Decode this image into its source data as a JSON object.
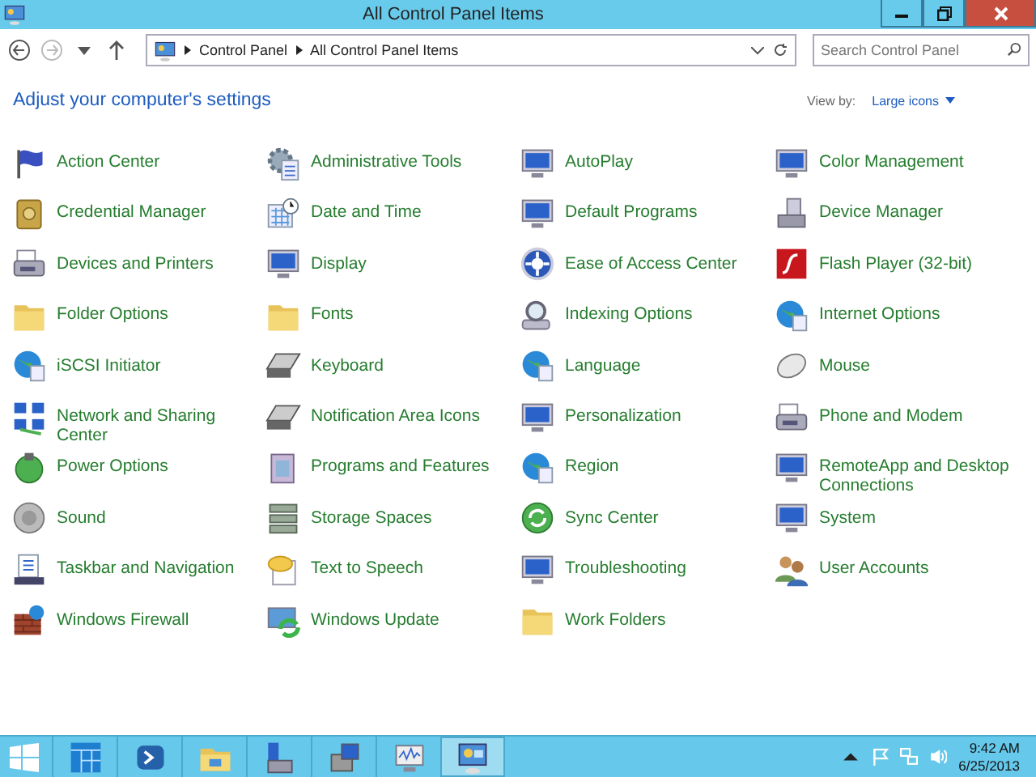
{
  "window": {
    "title": "All Control Panel Items"
  },
  "navigation": [
    {
      "kind": "back",
      "disabled": false
    },
    {
      "kind": "forward",
      "disabled": true
    },
    {
      "kind": "recent",
      "disabled": false
    },
    {
      "kind": "up",
      "disabled": false
    }
  ],
  "address_bar": {
    "path": [
      "Control Panel",
      "All Control Panel Items"
    ]
  },
  "search": {
    "placeholder": "Search Control Panel"
  },
  "heading": "Adjust your computer's settings",
  "view_by": {
    "label": "View by:",
    "value": "Large icons"
  },
  "items": [
    {
      "label": "Action Center"
    },
    {
      "label": "Administrative Tools"
    },
    {
      "label": "AutoPlay"
    },
    {
      "label": "Color Management"
    },
    {
      "label": "Credential Manager"
    },
    {
      "label": "Date and Time"
    },
    {
      "label": "Default Programs"
    },
    {
      "label": "Device Manager"
    },
    {
      "label": "Devices and Printers"
    },
    {
      "label": "Display"
    },
    {
      "label": "Ease of Access Center"
    },
    {
      "label": "Flash Player (32-bit)"
    },
    {
      "label": "Folder Options"
    },
    {
      "label": "Fonts"
    },
    {
      "label": "Indexing Options"
    },
    {
      "label": "Internet Options"
    },
    {
      "label": "iSCSI Initiator"
    },
    {
      "label": "Keyboard"
    },
    {
      "label": "Language"
    },
    {
      "label": "Mouse"
    },
    {
      "label": "Network and Sharing Center"
    },
    {
      "label": "Notification Area Icons"
    },
    {
      "label": "Personalization"
    },
    {
      "label": "Phone and Modem"
    },
    {
      "label": "Power Options"
    },
    {
      "label": "Programs and Features"
    },
    {
      "label": "Region"
    },
    {
      "label": "RemoteApp and Desktop Connections"
    },
    {
      "label": "Sound"
    },
    {
      "label": "Storage Spaces"
    },
    {
      "label": "Sync Center"
    },
    {
      "label": "System"
    },
    {
      "label": "Taskbar and Navigation"
    },
    {
      "label": "Text to Speech"
    },
    {
      "label": "Troubleshooting"
    },
    {
      "label": "User Accounts"
    },
    {
      "label": "Windows Firewall"
    },
    {
      "label": "Windows Update"
    },
    {
      "label": "Work Folders"
    }
  ],
  "taskbar": {
    "apps": [
      {
        "selected": false
      },
      {
        "selected": false
      },
      {
        "selected": false
      },
      {
        "selected": false
      },
      {
        "selected": false
      },
      {
        "selected": false
      },
      {
        "selected": true
      }
    ],
    "clock": {
      "time": "9:42 AM",
      "date": "6/25/2013"
    }
  }
}
